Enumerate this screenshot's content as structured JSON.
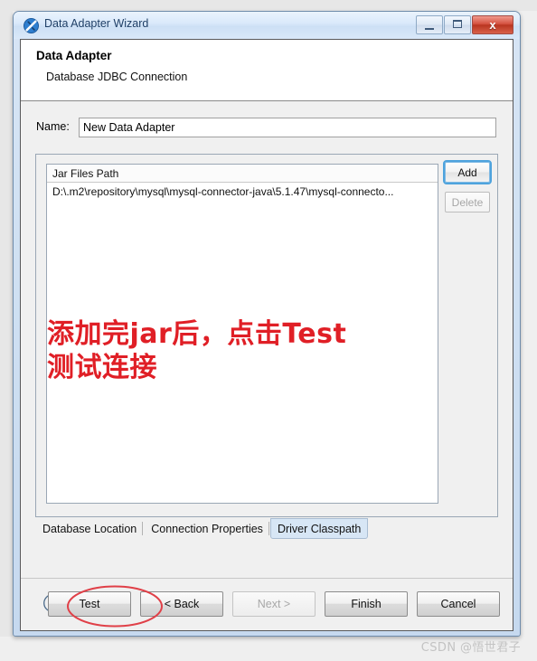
{
  "window": {
    "title": "Data Adapter Wizard",
    "icon": "data-adapter-icon",
    "controls": {
      "minimize": "minimize-icon",
      "maximize": "maximize-icon",
      "close": "x"
    }
  },
  "header": {
    "title": "Data Adapter",
    "subtitle": "Database JDBC Connection"
  },
  "name_field": {
    "label": "Name:",
    "value": "New Data Adapter",
    "placeholder": ""
  },
  "jar_list": {
    "column_header": "Jar Files Path",
    "rows": [
      "D:\\.m2\\repository\\mysql\\mysql-connector-java\\5.1.47\\mysql-connecto..."
    ]
  },
  "side_buttons": [
    {
      "label": "Add",
      "state": "focused"
    },
    {
      "label": "Delete",
      "state": "disabled"
    }
  ],
  "tabs": [
    {
      "label": "Database Location",
      "selected": false
    },
    {
      "label": "Connection Properties",
      "selected": false
    },
    {
      "label": "Driver Classpath",
      "selected": true
    }
  ],
  "dialog_buttons": [
    {
      "label": "Test",
      "state": "normal",
      "highlighted": true
    },
    {
      "label": "< Back",
      "state": "normal",
      "highlighted": false
    },
    {
      "label": "Next >",
      "state": "disabled",
      "highlighted": false
    },
    {
      "label": "Finish",
      "state": "normal",
      "highlighted": false
    },
    {
      "label": "Cancel",
      "state": "normal",
      "highlighted": false
    }
  ],
  "help_button": {
    "label": "?"
  },
  "annotation": {
    "line1": "添加完jar后，点击Test",
    "line2": "测试连接",
    "color": "#e01f26"
  },
  "watermark": "CSDN @悟世君子",
  "colors": {
    "accent": "#4ea3dd",
    "title_text": "#1f3f66",
    "annotation": "#e01f26",
    "tab_selected_bg": "#d7e6f5",
    "close_button": "#b93520"
  }
}
